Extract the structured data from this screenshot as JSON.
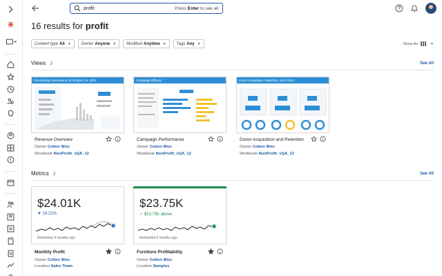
{
  "search": {
    "value": "profit",
    "hint_prefix": "Press ",
    "hint_key": "Enter",
    "hint_suffix": " to see all"
  },
  "results": {
    "count_text": "16 results for ",
    "query": "profit"
  },
  "filters": [
    {
      "label": "Content type",
      "value": "All"
    },
    {
      "label": "Owner",
      "value": "Anyone"
    },
    {
      "label": "Modified",
      "value": "Anytime"
    },
    {
      "label": "Tags",
      "value": "Any"
    }
  ],
  "show_as": "Show As",
  "views_section": {
    "title": "Views",
    "count": "3",
    "see_all": "See All"
  },
  "views": [
    {
      "name": "Revenue Overview",
      "owner_label": "Owner",
      "owner": "Colten Woo",
      "workbook_label": "Workbook",
      "workbook": "NonProfit_vQA_12",
      "thumb_title": "Fundraising Overview as of October 23, 2021"
    },
    {
      "name": "Campaign Performance",
      "owner_label": "Owner",
      "owner": "Colten Woo",
      "workbook_label": "Workbook",
      "workbook": "NonProfit_vQA_12",
      "thumb_title": "Campaign Efficacy"
    },
    {
      "name": "Donor Acquisition and Retention",
      "owner_label": "Owner",
      "owner": "Colten Woo",
      "workbook_label": "Workbook",
      "workbook": "NonProfit_vQA_12",
      "thumb_title": "Donor Acquisition, Retention, and Churn"
    }
  ],
  "metrics_section": {
    "title": "Metrics",
    "count": "2",
    "see_all": "See All"
  },
  "metrics": [
    {
      "value": "$24.01K",
      "delta": "▼ 19.21%",
      "refreshed": "Refreshed 4 months ago",
      "name": "Monthly Profit",
      "owner_label": "Owner",
      "owner": "Colten Woo",
      "location_label": "Location",
      "location": "Sales Team"
    },
    {
      "value": "$23.75K",
      "delta": "✓ $13.75K above",
      "refreshed": "Refreshed 6 months ago",
      "name": "Furniture Profitability",
      "owner_label": "Owner",
      "owner": "Colten Woo",
      "location_label": "Location",
      "location": "Samples"
    }
  ],
  "colors": {
    "accent": "#1f5aa6",
    "thumb_header": "#2f8fd6",
    "positive": "#1c8a4c",
    "negative": "#1f5aa6"
  }
}
